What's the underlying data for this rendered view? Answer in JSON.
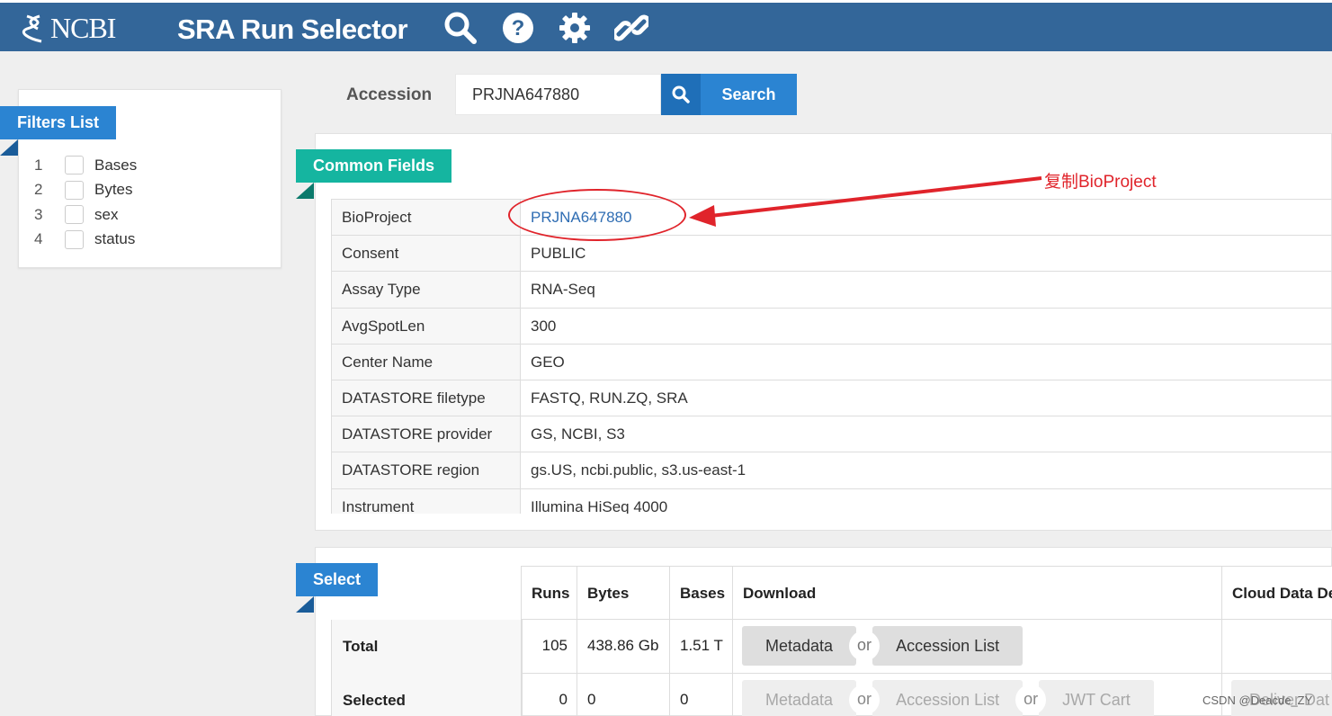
{
  "header": {
    "logo_text": "NCBI",
    "app_title": "SRA Run Selector",
    "icons": [
      "search-icon",
      "help-icon",
      "settings-gear-icon",
      "link-icon"
    ]
  },
  "filters": {
    "title": "Filters List",
    "items": [
      {
        "num": "1",
        "label": "Bases"
      },
      {
        "num": "2",
        "label": "Bytes"
      },
      {
        "num": "3",
        "label": "sex"
      },
      {
        "num": "4",
        "label": "status"
      }
    ]
  },
  "search": {
    "label": "Accession",
    "value": "PRJNA647880",
    "button_label": "Search"
  },
  "common_fields": {
    "title": "Common Fields",
    "rows": [
      {
        "key": "BioProject",
        "value": "PRJNA647880"
      },
      {
        "key": "Consent",
        "value": "PUBLIC"
      },
      {
        "key": "Assay Type",
        "value": "RNA-Seq"
      },
      {
        "key": "AvgSpotLen",
        "value": "300"
      },
      {
        "key": "Center Name",
        "value": "GEO"
      },
      {
        "key": "DATASTORE filetype",
        "value": "FASTQ, RUN.ZQ, SRA"
      },
      {
        "key": "DATASTORE provider",
        "value": "GS, NCBI, S3"
      },
      {
        "key": "DATASTORE region",
        "value": "gs.US, ncbi.public, s3.us-east-1"
      },
      {
        "key": "Instrument",
        "value": "Illumina HiSeq 4000"
      }
    ]
  },
  "annotation": {
    "text": "复制BioProject",
    "color": "#e0242b"
  },
  "select": {
    "title": "Select",
    "headers": {
      "runs": "Runs",
      "bytes": "Bytes",
      "bases": "Bases",
      "download": "Download",
      "cloud": "Cloud Data De"
    },
    "total": {
      "label": "Total",
      "runs": "105",
      "bytes": "438.86 Gb",
      "bases": "1.51 T",
      "metadata_btn": "Metadata",
      "or": "or",
      "accession_btn": "Accession List"
    },
    "selected": {
      "label": "Selected",
      "runs": "0",
      "bytes": "0",
      "bases": "0",
      "metadata_btn": "Metadata",
      "or1": "or",
      "accession_btn": "Accession List",
      "or2": "or",
      "jwt_btn": "JWT Cart",
      "cloud_btn": "Deliver Dat"
    }
  },
  "watermark": "CSDN @Deacde_ZY",
  "colors": {
    "header_bg": "#336699",
    "primary_blue": "#2b84d2",
    "teal": "#15b5a0",
    "annotation_red": "#e0242b"
  }
}
